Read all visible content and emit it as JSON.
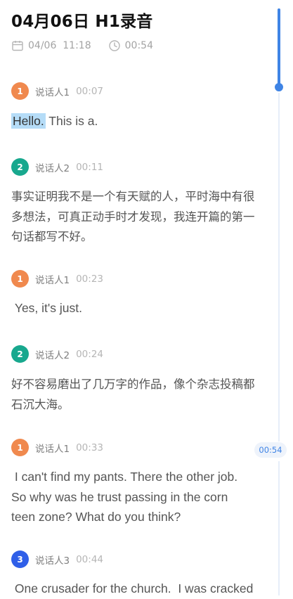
{
  "header": {
    "title": "04月06日 H1录音",
    "date": "04/06",
    "time": "11:18",
    "duration": "00:54"
  },
  "transcript": [
    {
      "badge": "1",
      "speaker": "说话人1",
      "timestamp": "00:07",
      "text_highlight": "Hello.",
      "text": " This is a."
    },
    {
      "badge": "2",
      "speaker": "说话人2",
      "timestamp": "00:11",
      "text": "事实证明我不是一个有天赋的人，平时海中有很多想法，可真正动手时才发现，我连开篇的第一句话都写不好。"
    },
    {
      "badge": "1",
      "speaker": "说话人1",
      "timestamp": "00:23",
      "text": " Yes, it's just."
    },
    {
      "badge": "2",
      "speaker": "说话人2",
      "timestamp": "00:24",
      "text": "好不容易磨出了几万字的作品，像个杂志投稿都石沉大海。"
    },
    {
      "badge": "1",
      "speaker": "说话人1",
      "timestamp": "00:33",
      "text": " I can't find my pants. There the other job. So why was he trust passing in the corn teen zone? What do you think?"
    },
    {
      "badge": "3",
      "speaker": "说话人3",
      "timestamp": "00:44",
      "text": " One crusader for the church.  I was cracked"
    }
  ],
  "scrubber": {
    "current_time": "00:54",
    "progress": 0.13
  },
  "colors": {
    "accent": "#3f84e5",
    "speaker1": "#f0894e",
    "speaker2": "#18a88e",
    "speaker3": "#2f5fe8",
    "highlight": "#b5dcf7"
  },
  "icons": {
    "date": "calendar-icon",
    "duration": "clock-icon"
  }
}
